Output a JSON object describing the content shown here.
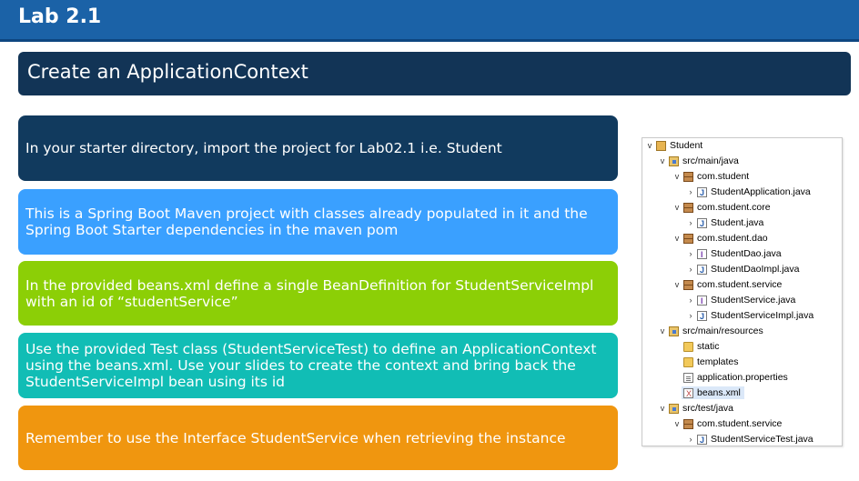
{
  "header": {
    "title": "Lab 2.1"
  },
  "subheader": {
    "title": "Create an ApplicationContext"
  },
  "steps": [
    "In your starter directory, import the project for Lab02.1 i.e. Student",
    "This is a Spring Boot Maven project with classes already populated in it and the Spring Boot Starter dependencies in the maven pom",
    "In the provided beans.xml define a single BeanDefinition for StudentServiceImpl with an id of “studentService”",
    "Use the provided Test class (StudentServiceTest) to define an ApplicationContext using the beans.xml. Use your slides to create the context and bring back the StudentServiceImpl bean using its id",
    "Remember to use the Interface StudentService when retrieving the instance"
  ],
  "step_colors": [
    "#113a5e",
    "#3aa0ff",
    "#8ccf06",
    "#11bdb5",
    "#f0960f"
  ],
  "project_tree": {
    "items": [
      {
        "label": "Student",
        "icon": "project-icon",
        "expanded": true
      },
      {
        "label": "src/main/java",
        "icon": "source-folder-icon",
        "expanded": true
      },
      {
        "label": "com.student",
        "icon": "package-icon",
        "expanded": true
      },
      {
        "label": "StudentApplication.java",
        "icon": "java-class-icon",
        "expanded": false
      },
      {
        "label": "com.student.core",
        "icon": "package-icon",
        "expanded": true
      },
      {
        "label": "Student.java",
        "icon": "java-class-icon",
        "expanded": false
      },
      {
        "label": "com.student.dao",
        "icon": "package-icon",
        "expanded": true
      },
      {
        "label": "StudentDao.java",
        "icon": "java-interface-icon",
        "expanded": false
      },
      {
        "label": "StudentDaoImpl.java",
        "icon": "java-class-icon",
        "expanded": false
      },
      {
        "label": "com.student.service",
        "icon": "package-icon",
        "expanded": true
      },
      {
        "label": "StudentService.java",
        "icon": "java-interface-icon",
        "expanded": false
      },
      {
        "label": "StudentServiceImpl.java",
        "icon": "java-class-icon",
        "expanded": false
      },
      {
        "label": "src/main/resources",
        "icon": "source-folder-icon",
        "expanded": true
      },
      {
        "label": "static",
        "icon": "folder-icon"
      },
      {
        "label": "templates",
        "icon": "folder-icon"
      },
      {
        "label": "application.properties",
        "icon": "properties-file-icon"
      },
      {
        "label": "beans.xml",
        "icon": "xml-file-icon",
        "selected": true
      },
      {
        "label": "src/test/java",
        "icon": "source-folder-icon",
        "expanded": true
      },
      {
        "label": "com.student.service",
        "icon": "package-icon",
        "expanded": true
      },
      {
        "label": "StudentServiceTest.java",
        "icon": "java-class-icon",
        "expanded": false
      }
    ]
  }
}
